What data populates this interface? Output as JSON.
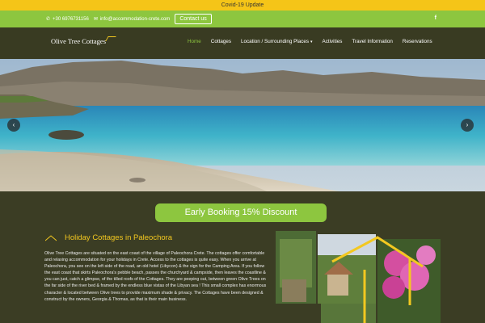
{
  "covid": {
    "text": "Covid-19 Update"
  },
  "topbar": {
    "phone": "+30 6976731156",
    "email": "info@accommodation-crete.com",
    "contact_label": "Contact us",
    "facebook_label": "f"
  },
  "nav": {
    "logo": "Olive Tree Cottages",
    "items": [
      {
        "label": "Home",
        "active": true
      },
      {
        "label": "Cottages"
      },
      {
        "label": "Location / Surrounding Places",
        "has_dropdown": true
      },
      {
        "label": "Activities"
      },
      {
        "label": "Travel Information"
      },
      {
        "label": "Reservations"
      }
    ]
  },
  "slider": {
    "prev": "‹",
    "next": "›"
  },
  "discount": {
    "label": "Early Booking 15% Discount"
  },
  "intro": {
    "title": "Holiday Cottages in Paleochora",
    "body": "Olive Tree Cottages are situated on the east coast of the village of Paleochora Crete. The cottages offer comfortable and relaxing accommodation for your holidays in Crete. Access to the cottages is quite easy. When you arrive at Paleochora, you see on the left side of the road, an old hotel (Libycon) & the sign for the Camping Area. If you follow the east coast that skirts Paleochora's pebble beach, passes the churchyard & campside, then leaves the coastline & you can just, catch a glimpse, of the tilled roofs of the Cottages. They are peeping out, between green Olive Trees on the far side of the river bed & framed by the endless blue vistas of the Libyan sea ! This small complex has enormous character & located between Olive trees to provide maximum shade & privacy. The Cottages have been designed & construct by the owners, Georgia & Thomas, as that is their main business."
  },
  "colors": {
    "accent_green": "#8dc63f",
    "accent_yellow": "#f3c820",
    "bg_olive": "#3b3d24"
  }
}
